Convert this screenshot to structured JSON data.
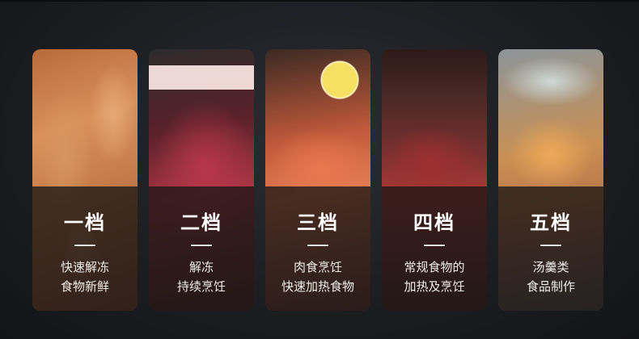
{
  "cards": [
    {
      "level": "一档",
      "desc": [
        "快速解冻",
        "食物新鲜"
      ],
      "food_icon": "shrimp-photo"
    },
    {
      "level": "二档",
      "desc": [
        "解冻",
        "持续烹饪"
      ],
      "food_icon": "raw-beef-photo"
    },
    {
      "level": "三档",
      "desc": [
        "肉食烹饪",
        "快速加热食物"
      ],
      "food_icon": "salmon-lemon-photo"
    },
    {
      "level": "四档",
      "desc": [
        "常规食物的",
        "加热及烹饪"
      ],
      "food_icon": "steak-rosemary-photo"
    },
    {
      "level": "五档",
      "desc": [
        "汤羹类",
        "食品制作"
      ],
      "food_icon": "soup-pot-photo"
    }
  ],
  "colors": {
    "background": "#1c1e22",
    "overlay": "#1c1614",
    "text": "#ffffff"
  }
}
